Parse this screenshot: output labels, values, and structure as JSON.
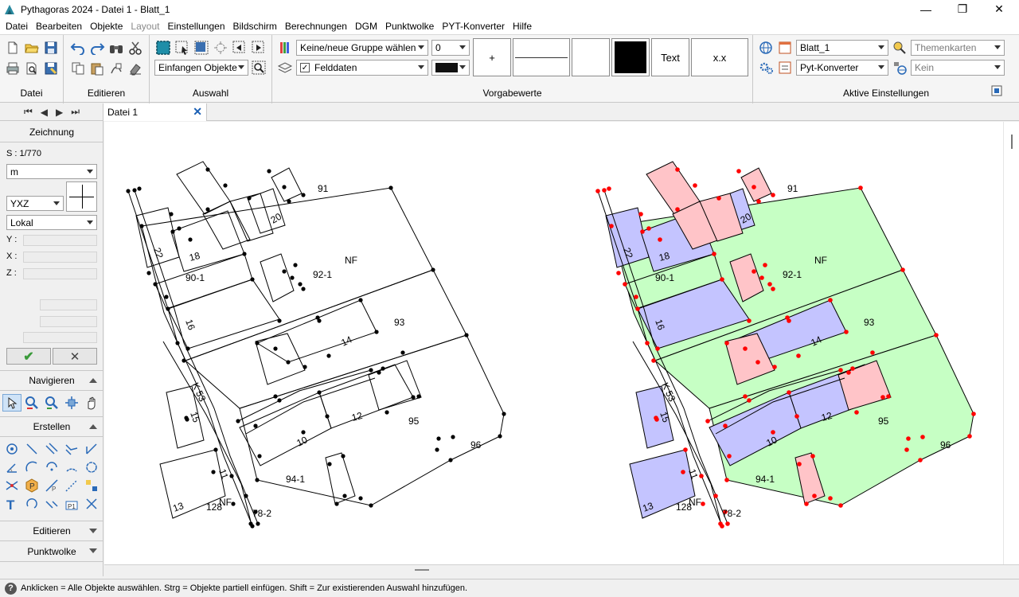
{
  "window": {
    "title": "Pythagoras 2024 - Datei 1 - Blatt_1",
    "minimize": "—",
    "maximize": "❐",
    "close": "✕"
  },
  "menu": [
    "Datei",
    "Bearbeiten",
    "Objekte",
    "Layout",
    "Einstellungen",
    "Bildschirm",
    "Berechnungen",
    "DGM",
    "Punktwolke",
    "PYT-Konverter",
    "Hilfe"
  ],
  "menu_disabled": [
    "Layout"
  ],
  "ribbon": {
    "groups": {
      "datei": "Datei",
      "editieren": "Editieren",
      "auswahl": "Auswahl",
      "vorgabewerte": "Vorgabewerte",
      "aktive": "Aktive Einstellungen"
    },
    "auswahl_combo": "Einfangen Objekte",
    "group_combo": "Keine/neue Gruppe wählen",
    "layer_combo": "Felddaten",
    "number_combo": "0",
    "btn_plus": "+",
    "btn_text": "Text",
    "btn_xx": "x.x",
    "blatt_combo": "Blatt_1",
    "konverter_combo": "Pyt-Konverter",
    "themen_combo": "Themenkarten",
    "kein_combo": "Kein"
  },
  "leftpanel": {
    "zeichnung": "Zeichnung",
    "scale": "S : 1/770",
    "unit": "m",
    "coord_order": "YXZ",
    "system": "Lokal",
    "y_label": "Y :",
    "x_label": "X :",
    "z_label": "Z :",
    "ok_icon": "✔",
    "cancel_icon": "✕",
    "navigieren": "Navigieren",
    "erstellen": "Erstellen",
    "editieren": "Editieren",
    "punktwolke": "Punktwolke"
  },
  "tab": {
    "label": "Datei 1",
    "close": "✕"
  },
  "drawing_labels": {
    "left": {
      "l91": "91",
      "l20": "20",
      "l18": "18",
      "l22": "22",
      "lNF": "NF",
      "l92_1": "92-1",
      "l90_1": "90-1",
      "l16": "16",
      "l93": "93",
      "l14": "14",
      "lK53": "K 53",
      "l15": "15",
      "l12": "12",
      "l95": "95",
      "l10": "10",
      "l96": "96",
      "l94_1": "94-1",
      "l11": "11",
      "l13": "13",
      "l128": "128",
      "lNF2": "NF",
      "l78_2": "78-2"
    },
    "right": {
      "l91": "91",
      "l20": "20",
      "l18": "18",
      "l22": "22",
      "lNF": "NF",
      "l92_1": "92-1",
      "l90_1": "90-1",
      "l16": "16",
      "l93": "93",
      "l14": "14",
      "lK53": "K 53",
      "l15": "15",
      "l12": "12",
      "l95": "95",
      "l10": "10",
      "l96": "96",
      "l94_1": "94-1",
      "l11": "11",
      "l13": "13",
      "l128": "128",
      "lNF2": "NF",
      "l78_2": "78-2"
    }
  },
  "colors": {
    "parcel_green": "#c6ffc4",
    "building_blue": "#c4c4ff",
    "building_pink": "#ffc4c8",
    "point_red": "#ff0000"
  },
  "status": "Anklicken = Alle Objekte auswählen. Strg = Objekte partiell einfügen. Shift = Zur existierenden Auswahl hinzufügen."
}
